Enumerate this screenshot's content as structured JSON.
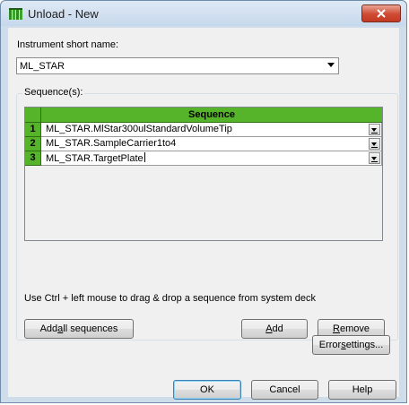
{
  "window": {
    "title": "Unload - New",
    "icon": "hamilton-tips-icon",
    "close_icon": "close-icon"
  },
  "instrument": {
    "label": "Instrument short name:",
    "selected": "ML_STAR"
  },
  "sequences": {
    "group_label": "Sequence(s):",
    "column_header": "Sequence",
    "rows": [
      {
        "num": "1",
        "value": "ML_STAR.MlStar300ulStandardVolumeTip"
      },
      {
        "num": "2",
        "value": "ML_STAR.SampleCarrier1to4"
      },
      {
        "num": "3",
        "value": "ML_STAR.TargetPlate"
      }
    ],
    "hint": "Use Ctrl + left mouse to drag & drop a sequence from system deck"
  },
  "buttons": {
    "add_all_pre": "Add ",
    "add_all_u": "a",
    "add_all_post": "ll sequences",
    "add_u": "A",
    "add_post": "dd",
    "remove_u": "R",
    "remove_post": "emove",
    "error_pre": "Error ",
    "error_u": "s",
    "error_post": "ettings...",
    "ok": "OK",
    "cancel": "Cancel",
    "help": "Help"
  },
  "colors": {
    "header_green": "#56b42a",
    "close_red": "#c43a22"
  }
}
